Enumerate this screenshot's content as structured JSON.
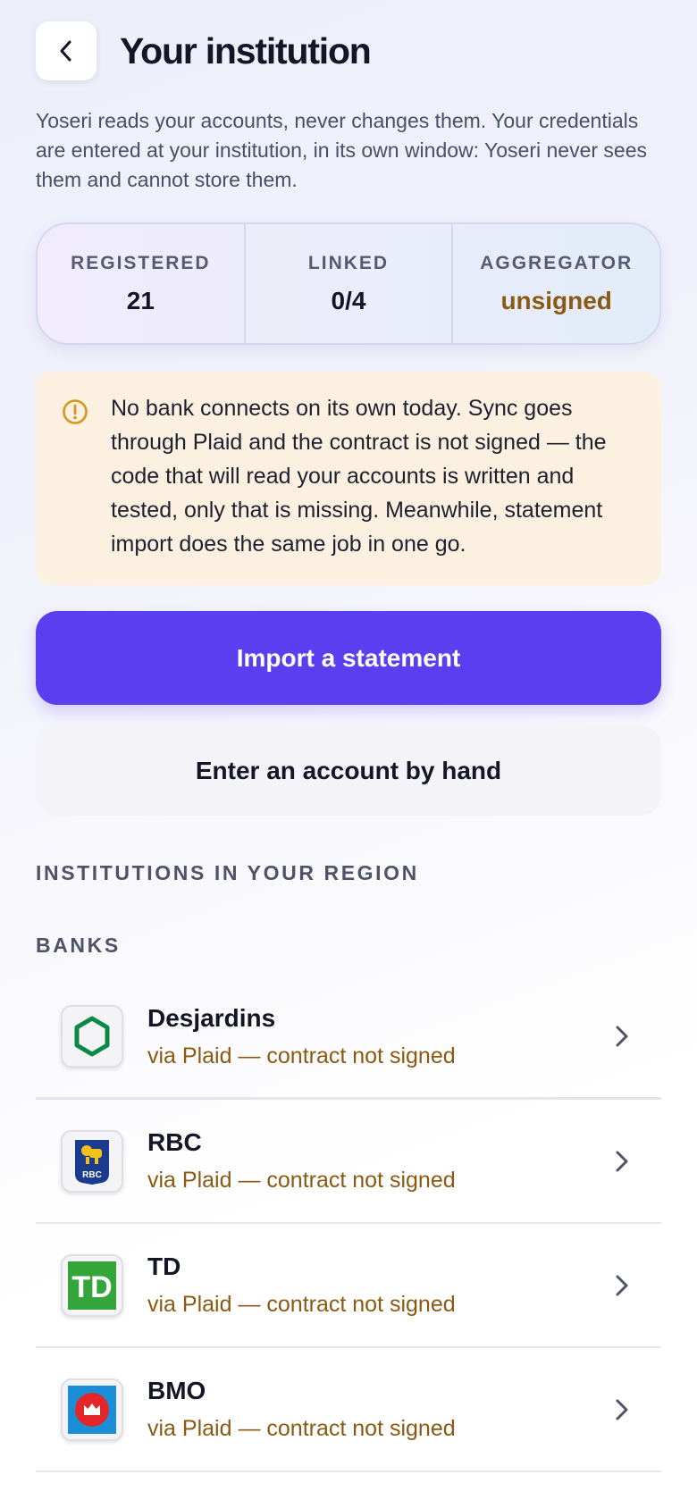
{
  "header": {
    "title": "Your institution",
    "back_icon": "chevron-left-icon"
  },
  "intro": "Yoseri reads your accounts, never changes them. Your credentials are entered at your institution, in its own window: Yoseri never sees them and cannot store them.",
  "stats": [
    {
      "label": "REGISTERED",
      "value": "21"
    },
    {
      "label": "LINKED",
      "value": "0/4"
    },
    {
      "label": "AGGREGATOR",
      "value": "unsigned"
    }
  ],
  "notice": {
    "icon": "warning-circle-icon",
    "text": "No bank connects on its own today. Sync goes through Plaid and the contract is not signed — the code that will read your accounts is written and tested, only that is missing. Meanwhile, statement import does the same job in one go."
  },
  "actions": {
    "primary": "Import a statement",
    "secondary": "Enter an account by hand"
  },
  "section_title": "INSTITUTIONS IN YOUR REGION",
  "group_title": "BANKS",
  "banks": [
    {
      "name": "Desjardins",
      "status": "via Plaid — contract not signed",
      "logo": "desjardins-logo"
    },
    {
      "name": "RBC",
      "status": "via Plaid — contract not signed",
      "logo": "rbc-logo"
    },
    {
      "name": "TD",
      "status": "via Plaid — contract not signed",
      "logo": "td-logo"
    },
    {
      "name": "BMO",
      "status": "via Plaid — contract not signed",
      "logo": "bmo-logo"
    }
  ],
  "colors": {
    "accent": "#5b3ef0",
    "warning_text": "#8a5a12",
    "notice_bg": "#fcf1e0",
    "notice_icon": "#d4961e"
  }
}
